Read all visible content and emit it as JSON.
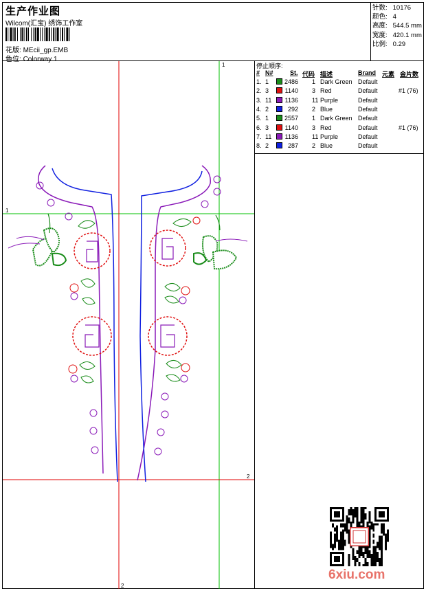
{
  "header": {
    "title": "生产作业图",
    "subtitle": "Wilcom(汇宝) 绣饰工作室",
    "design_label": "花版:",
    "design_value": "MEcii_gp.EMB",
    "colorway_label": "色位:",
    "colorway_value": "Colorway 1"
  },
  "stats": [
    {
      "label": "针数:",
      "value": "10176"
    },
    {
      "label": "颜色:",
      "value": "4"
    },
    {
      "label": "高度:",
      "value": "544.5 mm"
    },
    {
      "label": "宽度:",
      "value": "420.1 mm"
    },
    {
      "label": "比例:",
      "value": "0.29"
    }
  ],
  "stop_sequence": {
    "title": "停止顺序:",
    "headers": {
      "num": "#",
      "n": "N#",
      "st": "St.",
      "code": "代码",
      "desc": "描述",
      "brand": "Brand",
      "elem": "元素",
      "sequin": "金片数"
    },
    "rows": [
      {
        "num": "1.",
        "n": "1",
        "color": "#1a8c1a",
        "st": "2486",
        "code": "1",
        "desc": "Dark Green",
        "brand": "Default",
        "sequin": ""
      },
      {
        "num": "2.",
        "n": "3",
        "color": "#e01010",
        "st": "1140",
        "code": "3",
        "desc": "Red",
        "brand": "Default",
        "sequin": "#1 (76)"
      },
      {
        "num": "3.",
        "n": "11",
        "color": "#8a1ab8",
        "st": "1136",
        "code": "11",
        "desc": "Purple",
        "brand": "Default",
        "sequin": ""
      },
      {
        "num": "4.",
        "n": "2",
        "color": "#1020e0",
        "st": "292",
        "code": "2",
        "desc": "Blue",
        "brand": "Default",
        "sequin": ""
      },
      {
        "num": "5.",
        "n": "1",
        "color": "#1a8c1a",
        "st": "2557",
        "code": "1",
        "desc": "Dark Green",
        "brand": "Default",
        "sequin": ""
      },
      {
        "num": "6.",
        "n": "3",
        "color": "#e01010",
        "st": "1140",
        "code": "3",
        "desc": "Red",
        "brand": "Default",
        "sequin": "#1 (76)"
      },
      {
        "num": "7.",
        "n": "11",
        "color": "#8a1ab8",
        "st": "1136",
        "code": "11",
        "desc": "Purple",
        "brand": "Default",
        "sequin": ""
      },
      {
        "num": "8.",
        "n": "2",
        "color": "#1020e0",
        "st": "287",
        "code": "2",
        "desc": "Blue",
        "brand": "Default",
        "sequin": ""
      }
    ]
  },
  "guides": {
    "top_label": "1",
    "left_label": "1",
    "right_label": "2",
    "bottom_label": "2"
  },
  "watermark": "6xiu.com",
  "colors": {
    "green_guide": "#00c000",
    "red_guide": "#e00000",
    "thread_green": "#1a8c1a",
    "thread_red": "#e01010",
    "thread_purple": "#8a1ab8",
    "thread_blue": "#1020e0",
    "watermark": "#e8736a"
  }
}
